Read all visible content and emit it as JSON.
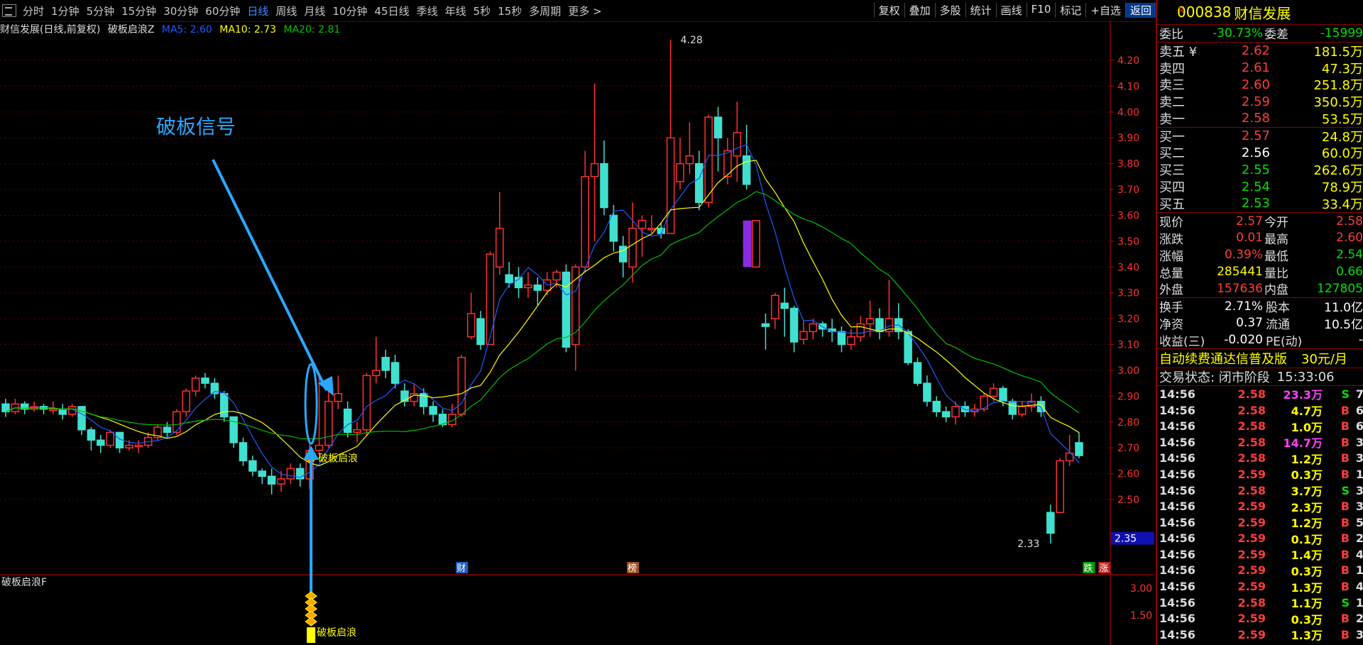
{
  "periods": [
    "分时",
    "1分钟",
    "5分钟",
    "15分钟",
    "30分钟",
    "60分钟",
    "日线",
    "周线",
    "月线",
    "10分钟",
    "45日线",
    "季线",
    "年线",
    "5秒",
    "15秒",
    "多周期",
    "更多 >"
  ],
  "active_period": "日线",
  "toolbar": [
    "复权",
    "叠加",
    "多股",
    "统计",
    "画线",
    "F10",
    "标记",
    "+自选",
    "返回"
  ],
  "chart": {
    "title": "财信发展(日线,前复权)",
    "indicator": "破板启浪Z",
    "ma5": "MA5: 2.60",
    "ma10": "MA10: 2.73",
    "ma20": "MA20: 2.81",
    "annotation": "破板信号",
    "signal_label": "破板启浪",
    "high_label": "4.28",
    "low_label": "2.33",
    "current_tag": "2.35",
    "event_tags": [
      "财",
      "榜",
      "跌",
      "涨"
    ],
    "y_ticks": [
      "4.20",
      "4.10",
      "4.00",
      "3.90",
      "3.80",
      "3.70",
      "3.60",
      "3.50",
      "3.40",
      "3.30",
      "3.20",
      "3.10",
      "3.00",
      "2.90",
      "2.80",
      "2.70",
      "2.60",
      "2.50"
    ],
    "colors": {
      "up": "#ff3030",
      "down": "#40e0d0",
      "ma5": "#1a5cff",
      "ma10": "#ffff00",
      "ma20": "#00c000",
      "grid": "#5a0000",
      "annot": "#2aa8ff"
    }
  },
  "chart_data": {
    "type": "candlestick",
    "ylim": [
      2.33,
      4.28
    ],
    "candles": [
      {
        "o": 2.87,
        "c": 2.84,
        "h": 2.89,
        "l": 2.82
      },
      {
        "o": 2.84,
        "c": 2.87,
        "h": 2.89,
        "l": 2.83
      },
      {
        "o": 2.87,
        "c": 2.85,
        "h": 2.88,
        "l": 2.83
      },
      {
        "o": 2.85,
        "c": 2.86,
        "h": 2.88,
        "l": 2.84
      },
      {
        "o": 2.86,
        "c": 2.85,
        "h": 2.87,
        "l": 2.83
      },
      {
        "o": 2.85,
        "c": 2.85,
        "h": 2.88,
        "l": 2.83
      },
      {
        "o": 2.85,
        "c": 2.83,
        "h": 2.87,
        "l": 2.81
      },
      {
        "o": 2.83,
        "c": 2.86,
        "h": 2.87,
        "l": 2.82
      },
      {
        "o": 2.86,
        "c": 2.77,
        "h": 2.86,
        "l": 2.75
      },
      {
        "o": 2.77,
        "c": 2.73,
        "h": 2.78,
        "l": 2.69
      },
      {
        "o": 2.73,
        "c": 2.71,
        "h": 2.75,
        "l": 2.68
      },
      {
        "o": 2.71,
        "c": 2.76,
        "h": 2.77,
        "l": 2.7
      },
      {
        "o": 2.76,
        "c": 2.7,
        "h": 2.76,
        "l": 2.68
      },
      {
        "o": 2.7,
        "c": 2.71,
        "h": 2.73,
        "l": 2.69
      },
      {
        "o": 2.71,
        "c": 2.71,
        "h": 2.73,
        "l": 2.68
      },
      {
        "o": 2.71,
        "c": 2.74,
        "h": 2.76,
        "l": 2.7
      },
      {
        "o": 2.74,
        "c": 2.78,
        "h": 2.79,
        "l": 2.73
      },
      {
        "o": 2.78,
        "c": 2.76,
        "h": 2.8,
        "l": 2.74
      },
      {
        "o": 2.76,
        "c": 2.84,
        "h": 2.85,
        "l": 2.75
      },
      {
        "o": 2.84,
        "c": 2.92,
        "h": 2.93,
        "l": 2.82
      },
      {
        "o": 2.92,
        "c": 2.97,
        "h": 2.98,
        "l": 2.9
      },
      {
        "o": 2.97,
        "c": 2.95,
        "h": 2.99,
        "l": 2.93
      },
      {
        "o": 2.95,
        "c": 2.91,
        "h": 2.97,
        "l": 2.89
      },
      {
        "o": 2.91,
        "c": 2.82,
        "h": 2.92,
        "l": 2.8
      },
      {
        "o": 2.82,
        "c": 2.72,
        "h": 2.82,
        "l": 2.7
      },
      {
        "o": 2.72,
        "c": 2.65,
        "h": 2.74,
        "l": 2.63
      },
      {
        "o": 2.65,
        "c": 2.61,
        "h": 2.67,
        "l": 2.59
      },
      {
        "o": 2.61,
        "c": 2.59,
        "h": 2.62,
        "l": 2.56
      },
      {
        "o": 2.59,
        "c": 2.56,
        "h": 2.62,
        "l": 2.52
      },
      {
        "o": 2.56,
        "c": 2.58,
        "h": 2.61,
        "l": 2.53
      },
      {
        "o": 2.58,
        "c": 2.62,
        "h": 2.64,
        "l": 2.56
      },
      {
        "o": 2.62,
        "c": 2.58,
        "h": 2.64,
        "l": 2.55
      },
      {
        "o": 2.58,
        "c": 2.69,
        "h": 2.73,
        "l": 2.54
      },
      {
        "o": 2.69,
        "c": 2.71,
        "h": 2.98,
        "l": 2.67
      },
      {
        "o": 2.71,
        "c": 2.88,
        "h": 2.96,
        "l": 2.7
      },
      {
        "o": 2.88,
        "c": 2.91,
        "h": 2.98,
        "l": 2.85
      },
      {
        "o": 2.85,
        "c": 2.76,
        "h": 2.88,
        "l": 2.74
      },
      {
        "o": 2.76,
        "c": 2.77,
        "h": 2.8,
        "l": 2.72
      },
      {
        "o": 2.77,
        "c": 2.98,
        "h": 2.99,
        "l": 2.75
      },
      {
        "o": 2.98,
        "c": 3.0,
        "h": 3.13,
        "l": 2.95
      },
      {
        "o": 3.05,
        "c": 3.0,
        "h": 3.08,
        "l": 2.97
      },
      {
        "o": 3.03,
        "c": 2.95,
        "h": 3.06,
        "l": 2.93
      },
      {
        "o": 2.92,
        "c": 2.88,
        "h": 2.95,
        "l": 2.86
      },
      {
        "o": 2.88,
        "c": 2.91,
        "h": 2.95,
        "l": 2.86
      },
      {
        "o": 2.91,
        "c": 2.86,
        "h": 2.93,
        "l": 2.83
      },
      {
        "o": 2.86,
        "c": 2.83,
        "h": 2.88,
        "l": 2.8
      },
      {
        "o": 2.83,
        "c": 2.79,
        "h": 2.85,
        "l": 2.78
      },
      {
        "o": 2.79,
        "c": 2.83,
        "h": 2.87,
        "l": 2.78
      },
      {
        "o": 2.83,
        "c": 3.05,
        "h": 3.06,
        "l": 2.82
      },
      {
        "o": 3.13,
        "c": 3.22,
        "h": 3.3,
        "l": 3.12
      },
      {
        "o": 3.2,
        "c": 3.1,
        "h": 3.23,
        "l": 3.08
      },
      {
        "o": 3.1,
        "c": 3.45,
        "h": 3.46,
        "l": 3.1
      },
      {
        "o": 3.4,
        "c": 3.55,
        "h": 3.69,
        "l": 3.37
      },
      {
        "o": 3.37,
        "c": 3.34,
        "h": 3.42,
        "l": 3.32
      },
      {
        "o": 3.36,
        "c": 3.32,
        "h": 3.4,
        "l": 3.28
      },
      {
        "o": 3.32,
        "c": 3.33,
        "h": 3.38,
        "l": 3.28
      },
      {
        "o": 3.33,
        "c": 3.31,
        "h": 3.36,
        "l": 3.25
      },
      {
        "o": 3.31,
        "c": 3.35,
        "h": 3.38,
        "l": 3.29
      },
      {
        "o": 3.35,
        "c": 3.38,
        "h": 3.39,
        "l": 3.32
      },
      {
        "o": 3.38,
        "c": 3.09,
        "h": 3.41,
        "l": 3.07
      },
      {
        "o": 3.1,
        "c": 3.4,
        "h": 3.41,
        "l": 3.0
      },
      {
        "o": 3.4,
        "c": 3.75,
        "h": 3.85,
        "l": 3.38
      },
      {
        "o": 3.75,
        "c": 3.8,
        "h": 4.11,
        "l": 3.5
      },
      {
        "o": 3.8,
        "c": 3.63,
        "h": 3.89,
        "l": 3.6
      },
      {
        "o": 3.6,
        "c": 3.5,
        "h": 3.64,
        "l": 3.46
      },
      {
        "o": 3.48,
        "c": 3.42,
        "h": 3.52,
        "l": 3.36
      },
      {
        "o": 3.4,
        "c": 3.55,
        "h": 3.65,
        "l": 3.34
      },
      {
        "o": 3.55,
        "c": 3.58,
        "h": 3.6,
        "l": 3.44
      },
      {
        "o": 3.55,
        "c": 3.55,
        "h": 3.6,
        "l": 3.53
      },
      {
        "o": 3.55,
        "c": 3.53,
        "h": 3.57,
        "l": 3.51
      },
      {
        "o": 3.53,
        "c": 3.9,
        "h": 4.28,
        "l": 3.89
      },
      {
        "o": 3.73,
        "c": 3.8,
        "h": 3.9,
        "l": 3.7
      },
      {
        "o": 3.8,
        "c": 3.83,
        "h": 3.96,
        "l": 3.76
      },
      {
        "o": 3.8,
        "c": 3.65,
        "h": 3.85,
        "l": 3.62
      },
      {
        "o": 3.65,
        "c": 3.98,
        "h": 3.99,
        "l": 3.63
      },
      {
        "o": 3.98,
        "c": 3.9,
        "h": 4.02,
        "l": 3.77
      },
      {
        "o": 3.75,
        "c": 3.85,
        "h": 3.9,
        "l": 3.72
      },
      {
        "o": 3.83,
        "c": 3.92,
        "h": 4.04,
        "l": 3.73
      },
      {
        "o": 3.83,
        "c": 3.72,
        "h": 3.95,
        "l": 3.7
      },
      {
        "o": 3.4,
        "c": 3.58,
        "h": 3.58,
        "l": 3.4
      },
      {
        "o": 3.18,
        "c": 3.17,
        "h": 3.22,
        "l": 3.08
      },
      {
        "o": 3.2,
        "c": 3.29,
        "h": 3.3,
        "l": 3.16
      },
      {
        "o": 3.26,
        "c": 3.24,
        "h": 3.32,
        "l": 3.13
      },
      {
        "o": 3.24,
        "c": 3.11,
        "h": 3.25,
        "l": 3.07
      },
      {
        "o": 3.12,
        "c": 3.15,
        "h": 3.19,
        "l": 3.1
      },
      {
        "o": 3.15,
        "c": 3.18,
        "h": 3.2,
        "l": 3.12
      },
      {
        "o": 3.18,
        "c": 3.16,
        "h": 3.19,
        "l": 3.13
      },
      {
        "o": 3.16,
        "c": 3.15,
        "h": 3.2,
        "l": 3.11
      },
      {
        "o": 3.15,
        "c": 3.1,
        "h": 3.17,
        "l": 3.07
      },
      {
        "o": 3.1,
        "c": 3.13,
        "h": 3.16,
        "l": 3.08
      },
      {
        "o": 3.13,
        "c": 3.18,
        "h": 3.21,
        "l": 3.11
      },
      {
        "o": 3.18,
        "c": 3.2,
        "h": 3.27,
        "l": 3.13
      },
      {
        "o": 3.2,
        "c": 3.15,
        "h": 3.24,
        "l": 3.12
      },
      {
        "o": 3.15,
        "c": 3.2,
        "h": 3.35,
        "l": 3.13
      },
      {
        "o": 3.2,
        "c": 3.15,
        "h": 3.26,
        "l": 3.12
      },
      {
        "o": 3.15,
        "c": 3.03,
        "h": 3.16,
        "l": 3.02
      },
      {
        "o": 3.03,
        "c": 2.95,
        "h": 3.05,
        "l": 2.94
      },
      {
        "o": 2.95,
        "c": 2.88,
        "h": 2.98,
        "l": 2.86
      },
      {
        "o": 2.88,
        "c": 2.84,
        "h": 2.9,
        "l": 2.82
      },
      {
        "o": 2.84,
        "c": 2.82,
        "h": 2.86,
        "l": 2.8
      },
      {
        "o": 2.82,
        "c": 2.86,
        "h": 2.88,
        "l": 2.79
      },
      {
        "o": 2.86,
        "c": 2.84,
        "h": 2.88,
        "l": 2.82
      },
      {
        "o": 2.84,
        "c": 2.85,
        "h": 2.87,
        "l": 2.82
      },
      {
        "o": 2.85,
        "c": 2.9,
        "h": 2.91,
        "l": 2.84
      },
      {
        "o": 2.9,
        "c": 2.93,
        "h": 2.95,
        "l": 2.88
      },
      {
        "o": 2.93,
        "c": 2.88,
        "h": 2.94,
        "l": 2.86
      },
      {
        "o": 2.88,
        "c": 2.83,
        "h": 2.89,
        "l": 2.81
      },
      {
        "o": 2.83,
        "c": 2.86,
        "h": 2.88,
        "l": 2.82
      },
      {
        "o": 2.86,
        "c": 2.88,
        "h": 2.91,
        "l": 2.84
      },
      {
        "o": 2.88,
        "c": 2.84,
        "h": 2.9,
        "l": 2.82
      },
      {
        "o": 2.45,
        "c": 2.37,
        "h": 2.48,
        "l": 2.33
      },
      {
        "o": 2.45,
        "c": 2.65,
        "h": 2.66,
        "l": 2.45
      },
      {
        "o": 2.65,
        "c": 2.68,
        "h": 2.75,
        "l": 2.63
      },
      {
        "o": 2.72,
        "c": 2.67,
        "h": 2.76,
        "l": 2.66
      }
    ],
    "signals_at_candle": [
      32
    ]
  },
  "sub_chart": {
    "title": "破板启浪F",
    "y_ticks": [
      "3.00",
      "1.50"
    ],
    "signal_label": "破板启浪"
  },
  "stock": {
    "marker": "R",
    "code": "000838",
    "name": "财信发展"
  },
  "weibi": {
    "label": "委比",
    "value": "-30.73%",
    "diff_label": "委差",
    "diff": "-15999"
  },
  "asks": [
    {
      "label": "卖五 ¥",
      "price": "2.62",
      "vol": "181.5万"
    },
    {
      "label": "卖四",
      "price": "2.61",
      "vol": "47.3万"
    },
    {
      "label": "卖三",
      "price": "2.60",
      "vol": "251.8万"
    },
    {
      "label": "卖二",
      "price": "2.59",
      "vol": "350.5万"
    },
    {
      "label": "卖一",
      "price": "2.58",
      "vol": "53.5万"
    }
  ],
  "bids": [
    {
      "label": "买一",
      "price": "2.57",
      "vol": "24.8万",
      "color": "red"
    },
    {
      "label": "买二",
      "price": "2.56",
      "vol": "60.0万",
      "color": "white"
    },
    {
      "label": "买三",
      "price": "2.55",
      "vol": "262.6万",
      "color": "green"
    },
    {
      "label": "买四",
      "price": "2.54",
      "vol": "78.9万",
      "color": "green"
    },
    {
      "label": "买五",
      "price": "2.53",
      "vol": "33.4万",
      "color": "green"
    }
  ],
  "quote": [
    {
      "l1": "现价",
      "v1": "2.57",
      "c1": "red",
      "l2": "今开",
      "v2": "2.58",
      "c2": "red"
    },
    {
      "l1": "涨跌",
      "v1": "0.01",
      "c1": "red",
      "l2": "最高",
      "v2": "2.60",
      "c2": "red"
    },
    {
      "l1": "涨幅",
      "v1": "0.39%",
      "c1": "red",
      "l2": "最低",
      "v2": "2.54",
      "c2": "green"
    },
    {
      "l1": "总量",
      "v1": "285441",
      "c1": "yellow",
      "l2": "量比",
      "v2": "0.66",
      "c2": "green"
    },
    {
      "l1": "外盘",
      "v1": "157636",
      "c1": "red",
      "l2": "内盘",
      "v2": "127805",
      "c2": "green"
    }
  ],
  "fundamentals": [
    {
      "l1": "换手",
      "v1": "2.71%",
      "l2": "股本",
      "v2": "11.0亿"
    },
    {
      "l1": "净资",
      "v1": "0.37",
      "l2": "流通",
      "v2": "10.5亿"
    },
    {
      "l1": "收益(三)",
      "v1": "-0.020",
      "l2": "PE(动)",
      "v2": "-"
    }
  ],
  "promo": {
    "text": "自动续费通达信普及版",
    "price": "30元/月"
  },
  "trade_state": {
    "label": "交易状态: 闭市阶段",
    "time": "15:33:06"
  },
  "ticks": [
    {
      "t": "14:56",
      "p": "2.58",
      "v": "23.3万",
      "s": "S",
      "n": "7",
      "vc": "magenta"
    },
    {
      "t": "14:56",
      "p": "2.58",
      "v": "4.7万",
      "s": "B",
      "n": "6",
      "vc": "yellow"
    },
    {
      "t": "14:56",
      "p": "2.58",
      "v": "1.0万",
      "s": "B",
      "n": "6",
      "vc": "yellow"
    },
    {
      "t": "14:56",
      "p": "2.58",
      "v": "14.7万",
      "s": "B",
      "n": "3",
      "vc": "magenta"
    },
    {
      "t": "14:56",
      "p": "2.58",
      "v": "1.2万",
      "s": "B",
      "n": "3",
      "vc": "yellow"
    },
    {
      "t": "14:56",
      "p": "2.59",
      "v": "0.3万",
      "s": "B",
      "n": "1",
      "vc": "yellow"
    },
    {
      "t": "14:56",
      "p": "2.58",
      "v": "3.7万",
      "s": "S",
      "n": "3",
      "vc": "yellow"
    },
    {
      "t": "14:56",
      "p": "2.59",
      "v": "2.3万",
      "s": "B",
      "n": "3",
      "vc": "yellow"
    },
    {
      "t": "14:56",
      "p": "2.59",
      "v": "1.2万",
      "s": "B",
      "n": "5",
      "vc": "yellow"
    },
    {
      "t": "14:56",
      "p": "2.59",
      "v": "0.1万",
      "s": "B",
      "n": "2",
      "vc": "yellow"
    },
    {
      "t": "14:56",
      "p": "2.59",
      "v": "1.4万",
      "s": "B",
      "n": "4",
      "vc": "yellow"
    },
    {
      "t": "14:56",
      "p": "2.59",
      "v": "0.3万",
      "s": "B",
      "n": "1",
      "vc": "yellow"
    },
    {
      "t": "14:56",
      "p": "2.59",
      "v": "1.3万",
      "s": "B",
      "n": "4",
      "vc": "yellow"
    },
    {
      "t": "14:56",
      "p": "2.58",
      "v": "1.1万",
      "s": "S",
      "n": "1",
      "vc": "yellow"
    },
    {
      "t": "14:56",
      "p": "2.59",
      "v": "0.3万",
      "s": "B",
      "n": "2",
      "vc": "yellow"
    },
    {
      "t": "14:56",
      "p": "2.59",
      "v": "1.3万",
      "s": "B",
      "n": "3",
      "vc": "yellow"
    }
  ]
}
